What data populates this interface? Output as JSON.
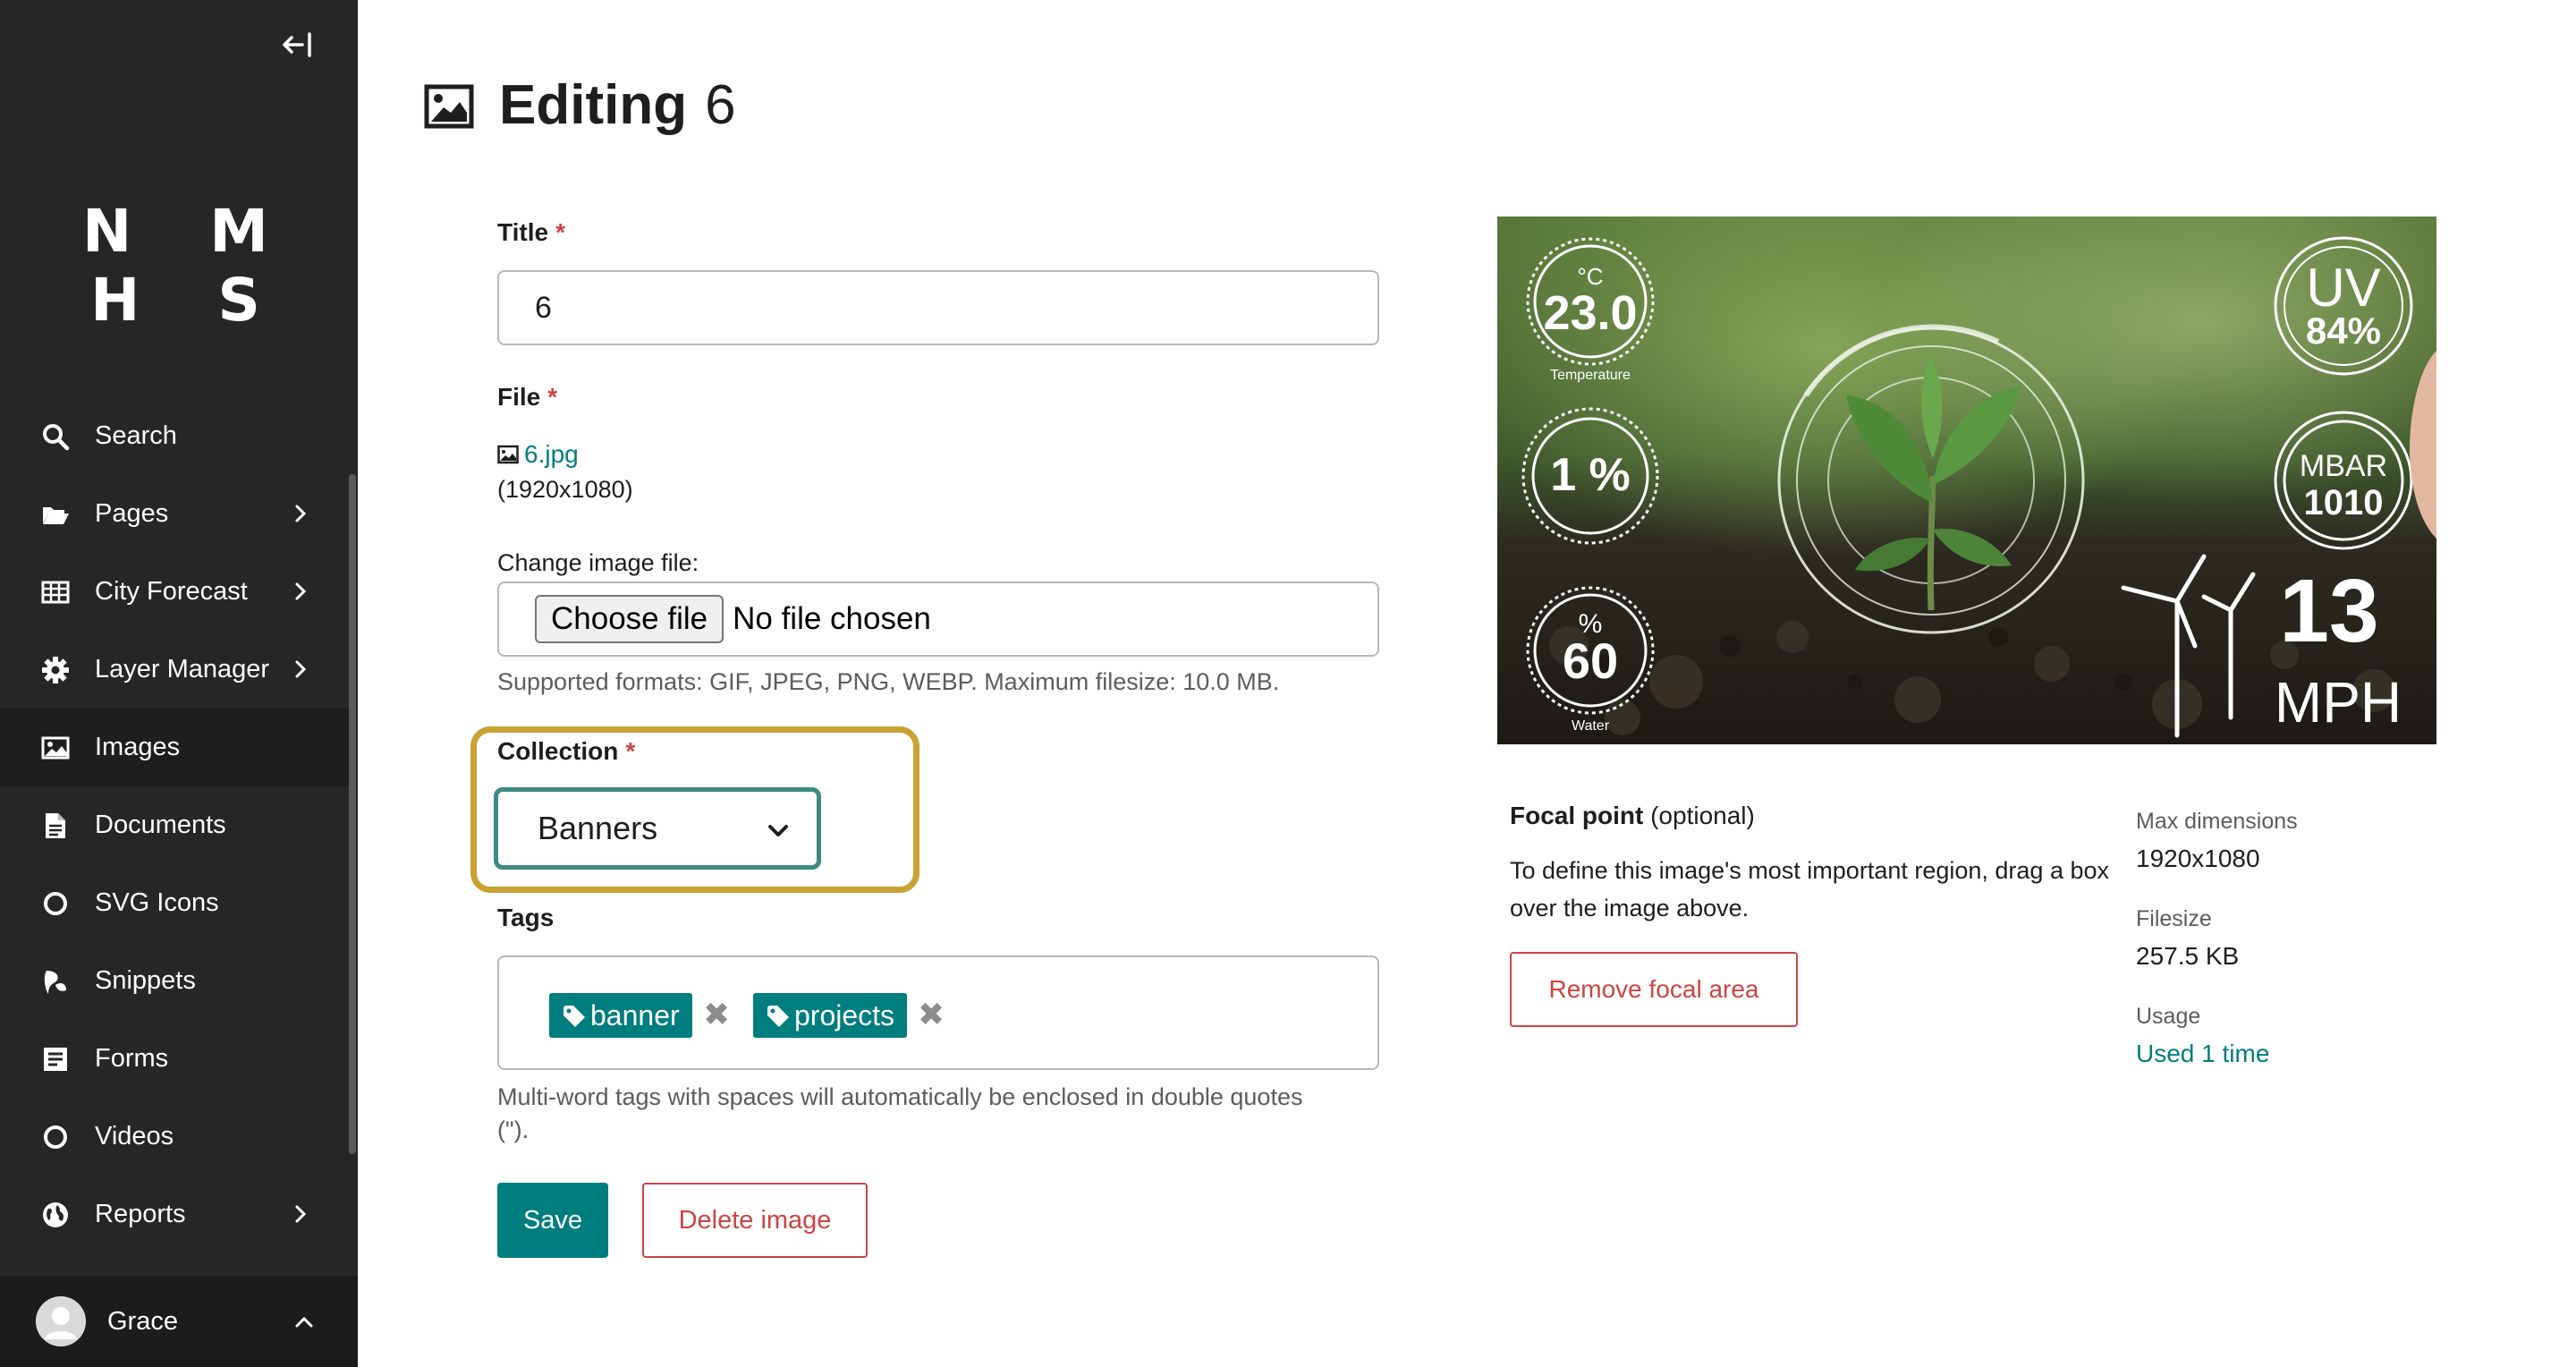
{
  "sidebar": {
    "logo": "N M H S",
    "items": [
      {
        "label": "Search",
        "icon": "search-icon",
        "chevron": false
      },
      {
        "label": "Pages",
        "icon": "folder-open-icon",
        "chevron": true
      },
      {
        "label": "City Forecast",
        "icon": "table-icon",
        "chevron": true
      },
      {
        "label": "Layer Manager",
        "icon": "cog-icon",
        "chevron": true
      },
      {
        "label": "Images",
        "icon": "image-icon",
        "chevron": false,
        "active": true
      },
      {
        "label": "Documents",
        "icon": "doc-icon",
        "chevron": false
      },
      {
        "label": "SVG Icons",
        "icon": "circle-icon",
        "chevron": false
      },
      {
        "label": "Snippets",
        "icon": "snippet-icon",
        "chevron": false
      },
      {
        "label": "Forms",
        "icon": "form-icon",
        "chevron": false
      },
      {
        "label": "Videos",
        "icon": "circle-icon",
        "chevron": false
      },
      {
        "label": "Reports",
        "icon": "globe-icon",
        "chevron": true
      }
    ],
    "user": {
      "name": "Grace"
    }
  },
  "header": {
    "title": "Editing",
    "title_suffix": "6"
  },
  "form": {
    "title_label": "Title",
    "required_mark": "*",
    "title_value": "6",
    "file_label": "File",
    "file_name": "6.jpg",
    "file_dims": "(1920x1080)",
    "change_label": "Change image file:",
    "choose_button": "Choose file",
    "no_file": "No file chosen",
    "formats_help": "Supported formats: GIF, JPEG, PNG, WEBP. Maximum filesize: 10.0 MB.",
    "collection_label": "Collection",
    "collection_value": "Banners",
    "tags_label": "Tags",
    "tags": [
      "banner",
      "projects"
    ],
    "tag_remove": "✖",
    "tags_help_line1": "Multi-word tags with spaces will automatically be enclosed in double quotes",
    "tags_help_line2": "(\").",
    "save_label": "Save",
    "delete_label": "Delete image"
  },
  "image_overlay": {
    "temperature_unit": "°C",
    "temperature_value": "23.0",
    "temperature_caption": "Temperature",
    "percent_value": "1 %",
    "water_unit": "%",
    "water_value": "60",
    "water_caption": "Water",
    "uv_label": "UV",
    "uv_value": "84%",
    "mbar_label": "MBAR",
    "mbar_value": "1010",
    "wind_value": "13",
    "wind_unit": "MPH"
  },
  "focal": {
    "title": "Focal point",
    "optional": "(optional)",
    "description": "To define this image's most important region, drag a box over the image above.",
    "remove_label": "Remove focal area"
  },
  "meta": {
    "max_dim_label": "Max dimensions",
    "max_dim_value": "1920x1080",
    "filesize_label": "Filesize",
    "filesize_value": "257.5 KB",
    "usage_label": "Usage",
    "usage_value": "Used 1 time"
  },
  "colors": {
    "sidebar_bg": "#262626",
    "accent": "#007d7e",
    "danger": "#cd4444",
    "highlight": "#c8a232",
    "select_border": "#3d8a80"
  }
}
